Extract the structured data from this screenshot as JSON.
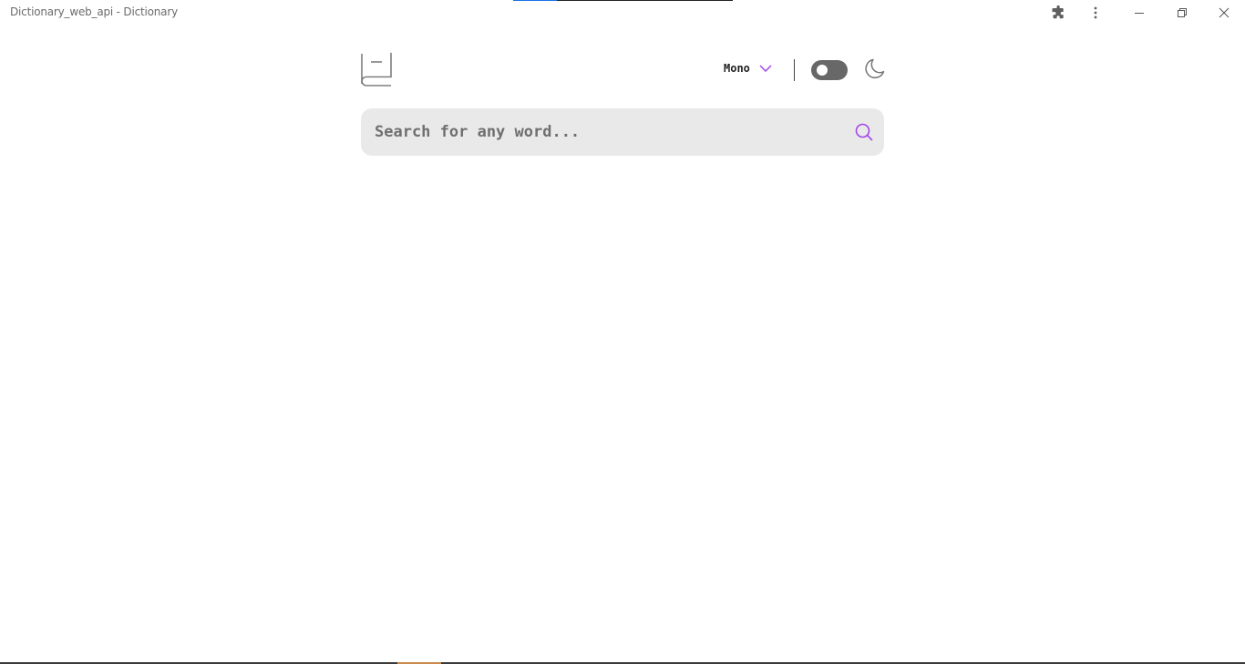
{
  "window": {
    "title": "Dictionary_web_api - Dictionary",
    "load_progress": 0.2
  },
  "titlebar": {
    "extensions_icon": "puzzle-icon",
    "menu_icon": "kebab-menu-icon",
    "minimize_icon": "minimize-icon",
    "restore_icon": "restore-icon",
    "close_icon": "close-icon"
  },
  "header": {
    "logo_icon": "book-icon",
    "font_select": {
      "selected": "Mono",
      "icon": "chevron-down-icon"
    },
    "theme_toggle": {
      "dark_mode": false,
      "icon": "moon-icon"
    }
  },
  "search": {
    "placeholder": "Search for any word...",
    "value": "",
    "icon": "search-icon"
  },
  "colors": {
    "accent": "#a445ed",
    "search_bg": "#e9e9e9",
    "toggle_bg": "#686868",
    "icon_gray": "#757575"
  }
}
